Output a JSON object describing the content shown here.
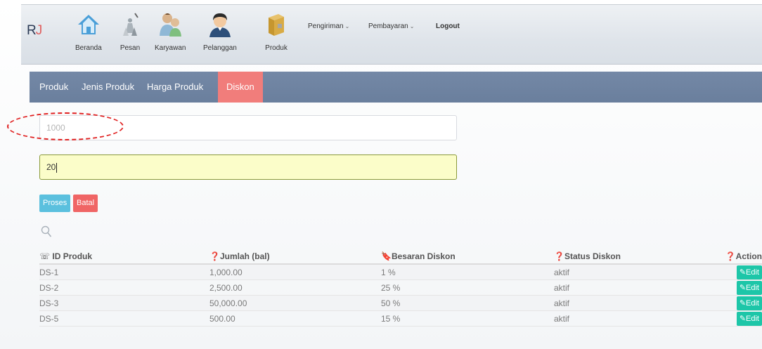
{
  "nav": {
    "brand_r": "R",
    "brand_j": "J",
    "items": [
      {
        "label": "Beranda",
        "icon": "home-icon"
      },
      {
        "label": "Pesan",
        "icon": "messages-icon"
      },
      {
        "label": "Karyawan",
        "icon": "employees-icon"
      },
      {
        "label": "Pelanggan",
        "icon": "customer-icon"
      },
      {
        "label": "Produk",
        "icon": "product-box-icon"
      }
    ],
    "pengiriman": "Pengiriman",
    "pembayaran": "Pembayaran",
    "logout": "Logout"
  },
  "subnav": {
    "tabs": [
      "Produk",
      "Jenis Produk",
      "Harga Produk",
      "Diskon"
    ],
    "active": "Diskon"
  },
  "form": {
    "jumlah_placeholder": "1000",
    "diskon_value": "20",
    "proses_label": "Proses",
    "batal_label": "Batal"
  },
  "table": {
    "headers": [
      "ID Produk",
      "Jumlah (bal)",
      "Besaran Diskon",
      "Status Diskon",
      "Action"
    ],
    "rows": [
      {
        "id": "DS-1",
        "jumlah": "1,000.00",
        "diskon": "1 %",
        "status": "aktif",
        "action": "Edit"
      },
      {
        "id": "DS-2",
        "jumlah": "2,500.00",
        "diskon": "25 %",
        "status": "aktif",
        "action": "Edit"
      },
      {
        "id": "DS-3",
        "jumlah": "50,000.00",
        "diskon": "50 %",
        "status": "aktif",
        "action": "Edit"
      },
      {
        "id": "DS-5",
        "jumlah": "500.00",
        "diskon": "15 %",
        "status": "aktif",
        "action": "Edit"
      }
    ]
  },
  "colors": {
    "subnav_bg": "#6f839f",
    "active_tab": "#f17d7b",
    "proses": "#5bc0de",
    "batal": "#f06565",
    "edit": "#1dc6a8",
    "highlight_field": "#fbfdc9",
    "annotation": "#e02020"
  }
}
